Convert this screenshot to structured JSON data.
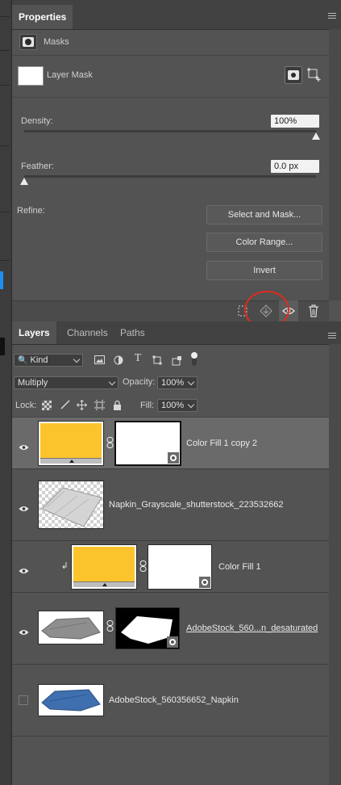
{
  "properties": {
    "tab_label": "Properties",
    "section_label": "Masks",
    "mask_label": "Layer Mask",
    "density": {
      "label": "Density:",
      "value": "100%",
      "level_percent": 100
    },
    "feather": {
      "label": "Feather:",
      "value": "0.0 px",
      "level_percent": 0
    },
    "refine_label": "Refine:",
    "buttons": {
      "select_and_mask": "Select and Mask...",
      "color_range": "Color Range...",
      "invert": "Invert"
    },
    "highlight_color": "#e02a1f"
  },
  "layers": {
    "tabs": [
      "Layers",
      "Channels",
      "Paths"
    ],
    "filter": {
      "kind": "Kind"
    },
    "blend_mode": "Multiply",
    "opacity": {
      "label": "Opacity:",
      "value": "100%"
    },
    "lock_label": "Lock:",
    "fill": {
      "label": "Fill:",
      "value": "100%"
    },
    "items": [
      {
        "name": "Color Fill 1 copy 2",
        "visible": true,
        "selected": true
      },
      {
        "name": "Napkin_Grayscale_shutterstock_223532662",
        "visible": true,
        "selected": false
      },
      {
        "name": "Color Fill 1",
        "visible": true,
        "selected": false,
        "clipped": true
      },
      {
        "name": "AdobeStock_560...n_desaturated",
        "visible": true,
        "selected": false,
        "underlined": true
      },
      {
        "name": "AdobeStock_560356652_Napkin",
        "visible": false,
        "selected": false
      }
    ]
  },
  "colors": {
    "fill_yellow": "#fcc42c",
    "panel_bg": "#535353",
    "selected_row": "#6a6a6a"
  }
}
